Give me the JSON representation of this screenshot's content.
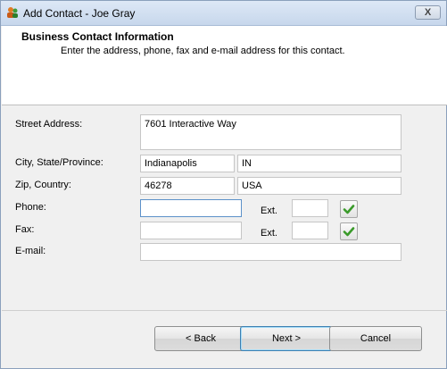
{
  "window": {
    "title": "Add Contact - Joe Gray",
    "close_glyph": "X"
  },
  "header": {
    "title": "Business Contact Information",
    "subtitle": "Enter the address, phone, fax and e-mail address for this contact."
  },
  "form": {
    "street_label": "Street Address:",
    "street_value": "7601 Interactive Way",
    "city_label": "City, State/Province:",
    "city_value": "Indianapolis",
    "state_value": "IN",
    "zip_label": "Zip, Country:",
    "zip_value": "46278",
    "country_value": "USA",
    "phone_label": "Phone:",
    "phone_value": "",
    "phone_ext_label": "Ext.",
    "phone_ext_value": "",
    "fax_label": "Fax:",
    "fax_value": "",
    "fax_ext_label": "Ext.",
    "fax_ext_value": "",
    "email_label": "E-mail:",
    "email_value": ""
  },
  "buttons": {
    "back": "< Back",
    "next": "Next >",
    "cancel": "Cancel"
  },
  "colors": {
    "check": "#3a9a2a",
    "header_bg": "#ffffff",
    "dialog_bg": "#f0f0f0"
  }
}
